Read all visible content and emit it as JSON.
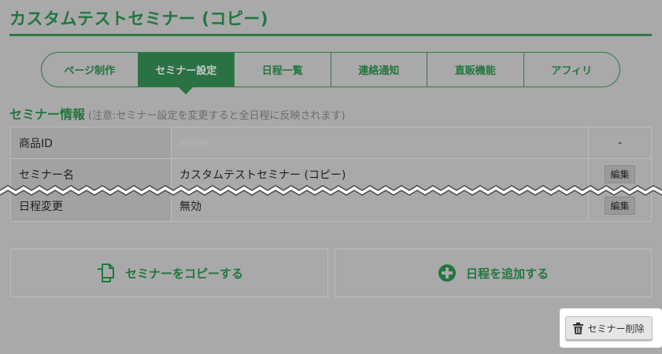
{
  "page": {
    "title": "カスタムテストセミナー (コピー)"
  },
  "tabs": [
    {
      "label": "ページ制作"
    },
    {
      "label": "セミナー設定",
      "active": true
    },
    {
      "label": "日程一覧"
    },
    {
      "label": "連絡通知"
    },
    {
      "label": "直販機能"
    },
    {
      "label": "アフィリ"
    }
  ],
  "section": {
    "heading": "セミナー情報",
    "note": "(注意:セミナー設定を変更すると全日程に反映されます)"
  },
  "table": {
    "rows": [
      {
        "key": "商品ID",
        "value": "53188",
        "action": "-"
      },
      {
        "key": "セミナー名",
        "value": "カスタムテストセミナー (コピー)",
        "action": "編集"
      },
      {
        "key": "日程変更",
        "value": "無効",
        "action": "編集"
      }
    ]
  },
  "actions": {
    "copy_label": "セミナーをコピーする",
    "add_label": "日程を追加する"
  },
  "delete_button": {
    "label": "セミナー削除"
  },
  "colors": {
    "accent": "#22763e",
    "overlay": "#a9a9a9"
  },
  "icons": {
    "copy": "copy-icon",
    "add": "plus-circle-icon",
    "delete": "trash-icon"
  }
}
